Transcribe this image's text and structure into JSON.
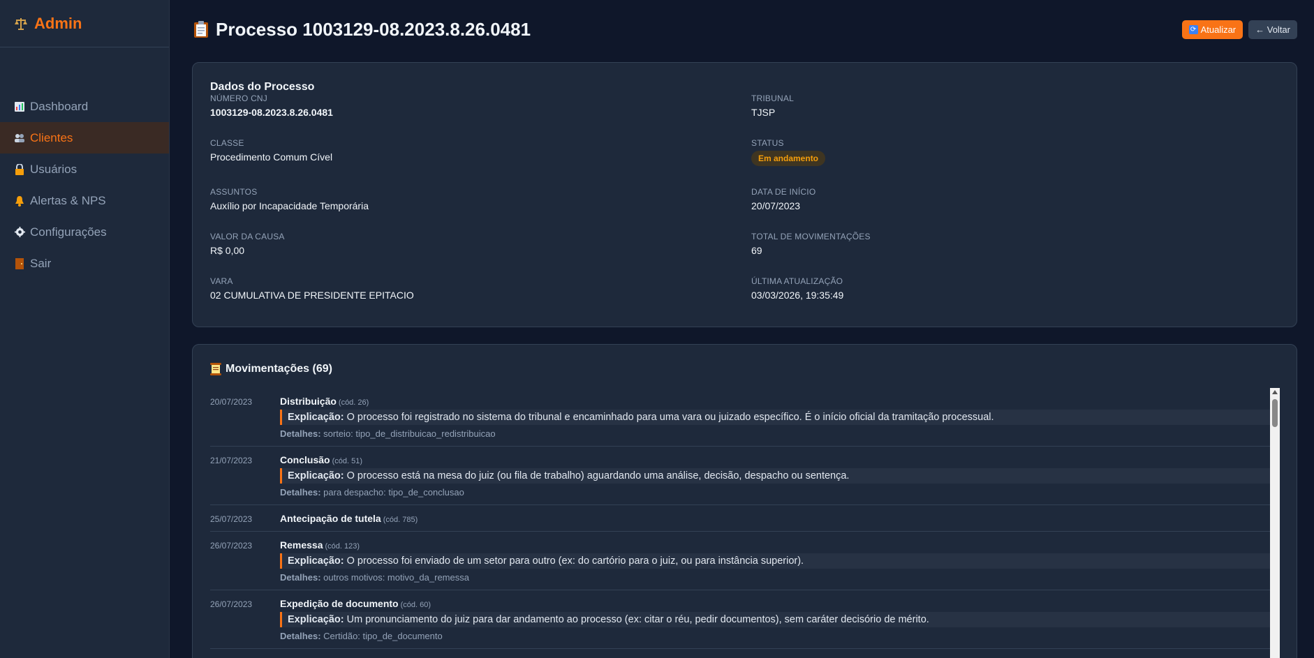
{
  "sidebar": {
    "brand": "Admin",
    "items": [
      {
        "label": "Dashboard",
        "icon": "chart-icon"
      },
      {
        "label": "Clientes",
        "icon": "clients-icon"
      },
      {
        "label": "Usuários",
        "icon": "lock-icon"
      },
      {
        "label": "Alertas & NPS",
        "icon": "bell-icon"
      },
      {
        "label": "Configurações",
        "icon": "gear-icon"
      },
      {
        "label": "Sair",
        "icon": "door-icon"
      }
    ],
    "active_index": 1
  },
  "header": {
    "title": "Processo 1003129-08.2023.8.26.0481",
    "refresh_label": "Atualizar",
    "back_label": "← Voltar"
  },
  "process": {
    "card_title": "Dados do Processo",
    "numero_cnj": {
      "label": "NÚMERO CNJ",
      "value": "1003129-08.2023.8.26.0481"
    },
    "tribunal": {
      "label": "TRIBUNAL",
      "value": "TJSP"
    },
    "classe": {
      "label": "CLASSE",
      "value": "Procedimento Comum Cível"
    },
    "status": {
      "label": "STATUS",
      "value": "Em andamento"
    },
    "assuntos": {
      "label": "ASSUNTOS",
      "value": "Auxílio por Incapacidade Temporária"
    },
    "data_inicio": {
      "label": "DATA DE INÍCIO",
      "value": "20/07/2023"
    },
    "valor_causa": {
      "label": "VALOR DA CAUSA",
      "value": "R$ 0,00"
    },
    "total_movs": {
      "label": "TOTAL DE MOVIMENTAÇÕES",
      "value": "69"
    },
    "vara": {
      "label": "VARA",
      "value": "02 CUMULATIVA DE PRESIDENTE EPITACIO"
    },
    "ultima_atualizacao": {
      "label": "ÚLTIMA ATUALIZAÇÃO",
      "value": "03/03/2026, 19:35:49"
    }
  },
  "movements": {
    "title": "Movimentações (69)",
    "expl_label": "Explicação:",
    "det_label": "Detalhes:",
    "items": [
      {
        "date": "20/07/2023",
        "name": "Distribuição",
        "code": "(cód. 26)",
        "expl": "O processo foi registrado no sistema do tribunal e encaminhado para uma vara ou juizado específico. É o início oficial da tramitação processual.",
        "det": "sorteio: tipo_de_distribuicao_redistribuicao"
      },
      {
        "date": "21/07/2023",
        "name": "Conclusão",
        "code": "(cód. 51)",
        "expl": "O processo está na mesa do juiz (ou fila de trabalho) aguardando uma análise, decisão, despacho ou sentença.",
        "det": "para despacho: tipo_de_conclusao"
      },
      {
        "date": "25/07/2023",
        "name": "Antecipação de tutela",
        "code": "(cód. 785)",
        "expl": "",
        "det": ""
      },
      {
        "date": "26/07/2023",
        "name": "Remessa",
        "code": "(cód. 123)",
        "expl": "O processo foi enviado de um setor para outro (ex: do cartório para o juiz, ou para instância superior).",
        "det": "outros motivos: motivo_da_remessa"
      },
      {
        "date": "26/07/2023",
        "name": "Expedição de documento",
        "code": "(cód. 60)",
        "expl": "Um pronunciamento do juiz para dar andamento ao processo (ex: citar o réu, pedir documentos), sem caráter decisório de mérito.",
        "det": "Certidão: tipo_de_documento"
      }
    ]
  },
  "colors": {
    "accent": "#f97316",
    "background": "#0f172a",
    "card": "#1e293b"
  }
}
